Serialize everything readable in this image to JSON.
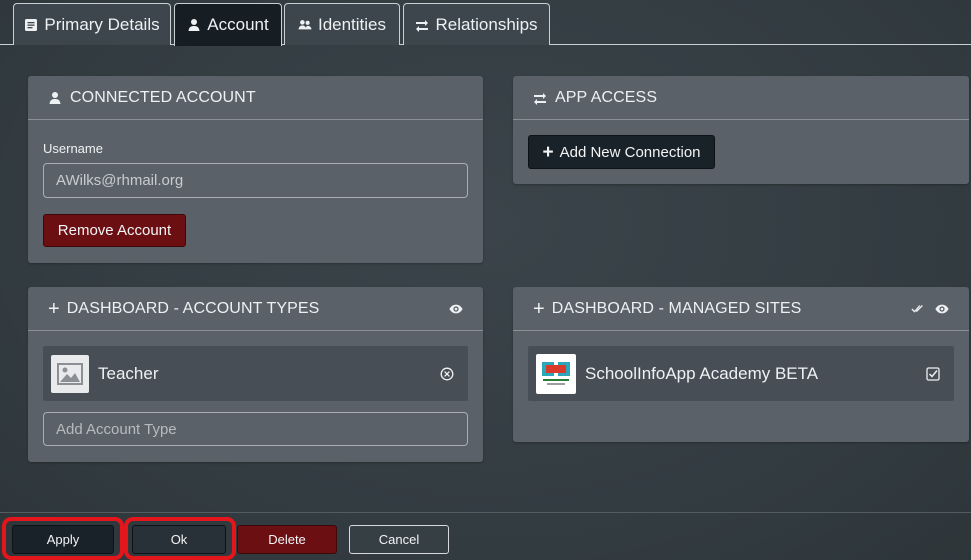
{
  "tabs": [
    {
      "label": "Primary Details",
      "icon": "document-icon"
    },
    {
      "label": "Account",
      "icon": "user-icon",
      "active": true
    },
    {
      "label": "Identities",
      "icon": "identities-icon"
    },
    {
      "label": "Relationships",
      "icon": "swap-icon"
    }
  ],
  "connected_account": {
    "title": "CONNECTED ACCOUNT",
    "username_label": "Username",
    "username_value": "AWilks@rhmail.org",
    "remove_button": "Remove Account"
  },
  "app_access": {
    "title": "APP ACCESS",
    "add_button": "Add New Connection"
  },
  "account_types": {
    "title": "DASHBOARD - ACCOUNT TYPES",
    "items": [
      {
        "label": "Teacher"
      }
    ],
    "add_placeholder": "Add Account Type"
  },
  "managed_sites": {
    "title": "DASHBOARD - MANAGED SITES",
    "items": [
      {
        "label": "SchoolInfoApp Academy BETA"
      }
    ]
  },
  "footer": {
    "apply": "Apply",
    "ok": "Ok",
    "delete": "Delete",
    "cancel": "Cancel"
  },
  "colors": {
    "background": "#363f44",
    "panel": "#5a6168",
    "active_tab": "#161d23",
    "danger": "#6b0f12",
    "highlight": "#e3161b"
  }
}
